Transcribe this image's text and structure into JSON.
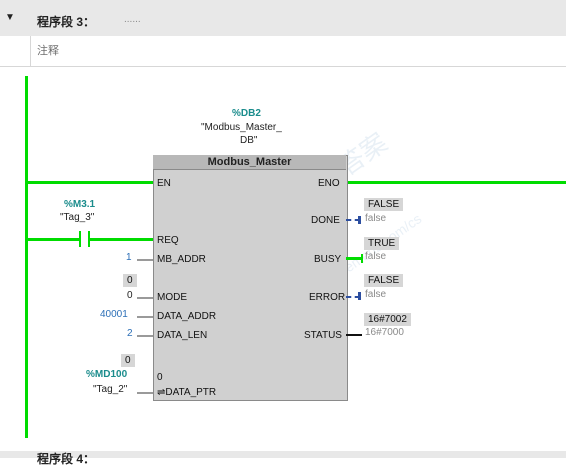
{
  "segment": {
    "arrow": "▼",
    "title": "程序段 3：",
    "dots": "......",
    "comment": "注释"
  },
  "block": {
    "db_address": "%DB2",
    "db_name_1": "\"Modbus_Master_",
    "db_name_2": "DB\"",
    "title": "Modbus_Master",
    "pins_left": {
      "en": "EN",
      "req": "REQ",
      "mb_addr": "MB_ADDR",
      "mode": "MODE",
      "data_addr": "DATA_ADDR",
      "data_len": "DATA_LEN",
      "data_ptr": "⇌DATA_PTR",
      "data_ptr_val": "0"
    },
    "pins_right": {
      "eno": "ENO",
      "done": "DONE",
      "busy": "BUSY",
      "error": "ERROR",
      "status": "STATUS"
    }
  },
  "contact": {
    "address": "%M3.1",
    "name": "\"Tag_3\""
  },
  "inputs": {
    "mb_addr": "1",
    "mode_box": "0",
    "mode": "0",
    "data_addr": "40001",
    "data_len": "2",
    "ptr_box": "0",
    "ptr_address": "%MD100",
    "ptr_name": "\"Tag_2\""
  },
  "outputs": {
    "done_box": "FALSE",
    "done": "false",
    "busy_box": "TRUE",
    "busy": "false",
    "error_box": "FALSE",
    "error": "false",
    "status_box": "16#7002",
    "status": "16#7000"
  },
  "next_segment": {
    "title": "程序段 4："
  },
  "watermark": {
    "line1": "西门子工业",
    "line2": "support.industry.siemens.com/cs",
    "line3": "找答案"
  },
  "colors": {
    "power": "#00dc00",
    "teal": "#1a8c8c",
    "blue": "#2c6fb7"
  }
}
